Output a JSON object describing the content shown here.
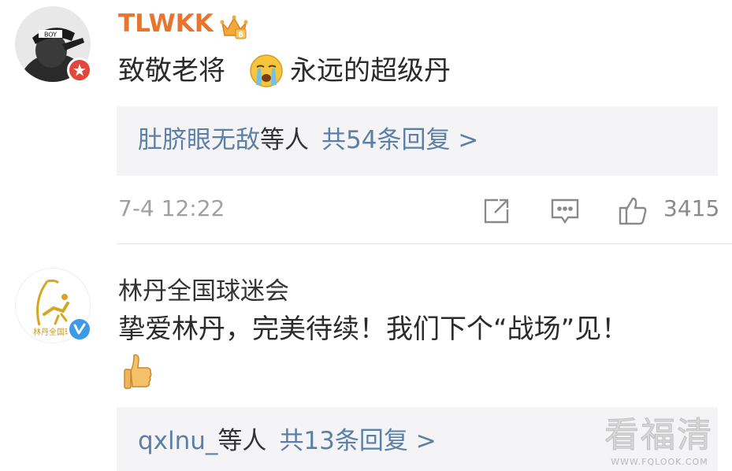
{
  "comments": [
    {
      "username": "TLWKK",
      "text_before_emoji": "致敬老将",
      "text_after_emoji": "永远的超级丹",
      "emoji": "crying-face-emoji",
      "user_badge": "crown-level-6-icon",
      "avatar_badge": "red-verified-icon",
      "replies": {
        "names": "肚脐眼无敌",
        "suffix": "等人",
        "count_text": "共54条回复 >"
      },
      "timestamp": "7-4 12:22",
      "actions": {
        "share_icon": "share-icon",
        "comment_icon": "comment-icon",
        "like_icon": "like-icon",
        "like_count": "3415"
      }
    },
    {
      "username": "林丹全国球迷会",
      "avatar_text": "林丹全国球",
      "text": "挚爱林丹，完美待续！我们下个“战场”见！",
      "emoji": "thumbs-up-emoji",
      "avatar_badge": "blue-verified-icon",
      "replies": {
        "names": "qxlnu_",
        "suffix": "等人",
        "count_text": "共13条回复 >"
      }
    }
  ],
  "watermark": {
    "main": "看福清",
    "sub": "WWW.FQLOOK.COM"
  },
  "colors": {
    "username_vip": "#e8742e",
    "link_blue": "#5b7fa6",
    "reply_bg": "#f4f4f6",
    "meta_gray": "#a0a0a0"
  }
}
